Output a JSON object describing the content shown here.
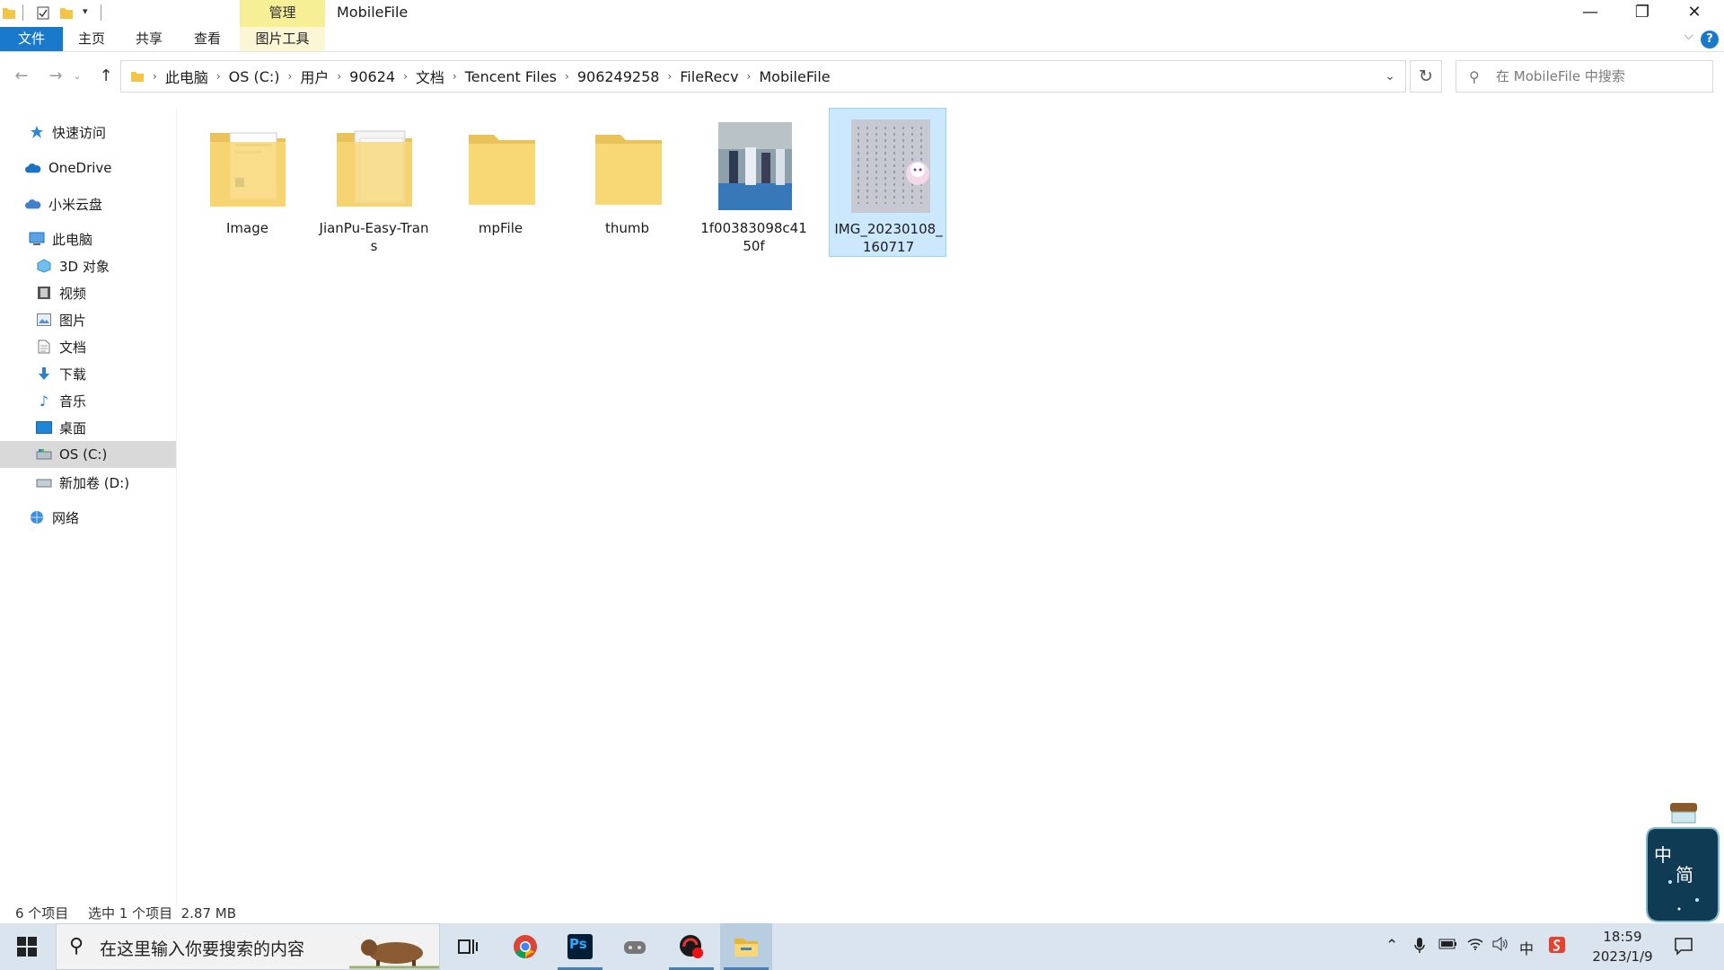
{
  "window": {
    "title": "MobileFile",
    "context_tab": "管理",
    "minimize": "—",
    "maximize": "❐",
    "close": "✕"
  },
  "ribbon": {
    "tabs": [
      "文件",
      "主页",
      "共享",
      "查看",
      "图片工具"
    ],
    "help": "?"
  },
  "address": {
    "crumbs": [
      "此电脑",
      "OS (C:)",
      "用户",
      "90624",
      "文档",
      "Tencent Files",
      "906249258",
      "FileRecv",
      "MobileFile"
    ],
    "search_placeholder": "在 MobileFile 中搜索"
  },
  "sidebar": {
    "items": [
      {
        "label": "快速访问",
        "icon": "star-icon"
      },
      {
        "label": "OneDrive",
        "icon": "cloud-icon"
      },
      {
        "label": "小米云盘",
        "icon": "cloud-drive-icon"
      },
      {
        "label": "此电脑",
        "icon": "computer-icon"
      },
      {
        "label": "3D 对象",
        "icon": "cube-icon"
      },
      {
        "label": "视频",
        "icon": "video-icon"
      },
      {
        "label": "图片",
        "icon": "picture-icon"
      },
      {
        "label": "文档",
        "icon": "document-icon"
      },
      {
        "label": "下载",
        "icon": "download-icon"
      },
      {
        "label": "音乐",
        "icon": "music-icon"
      },
      {
        "label": "桌面",
        "icon": "desktop-icon"
      },
      {
        "label": "OS (C:)",
        "icon": "drive-icon"
      },
      {
        "label": "新加卷 (D:)",
        "icon": "drive-icon"
      },
      {
        "label": "网络",
        "icon": "network-icon"
      }
    ],
    "selected": "OS (C:)"
  },
  "files": [
    {
      "name": "Image",
      "type": "folder"
    },
    {
      "name": "JianPu-Easy-Trans",
      "type": "folder"
    },
    {
      "name": "mpFile",
      "type": "folder"
    },
    {
      "name": "thumb",
      "type": "folder"
    },
    {
      "name": "1f00383098c4150f",
      "type": "image"
    },
    {
      "name": "IMG_20230108_160717",
      "type": "image",
      "selected": true
    }
  ],
  "status": {
    "count": "6 个项目",
    "selection": "选中 1 个项目  2.87 MB"
  },
  "ime": {
    "lang": "中",
    "mode": "简"
  },
  "taskbar": {
    "search_placeholder": "在这里输入你要搜索的内容",
    "time": "18:59",
    "date": "2023/1/9",
    "ime_tray": "中",
    "ps_label": "Ps"
  },
  "colors": {
    "accent": "#1979ca",
    "manage_tab": "#f7ef95",
    "selection": "#cce8ff",
    "folder": "#f8d775",
    "taskbar": "#dae4ee"
  }
}
